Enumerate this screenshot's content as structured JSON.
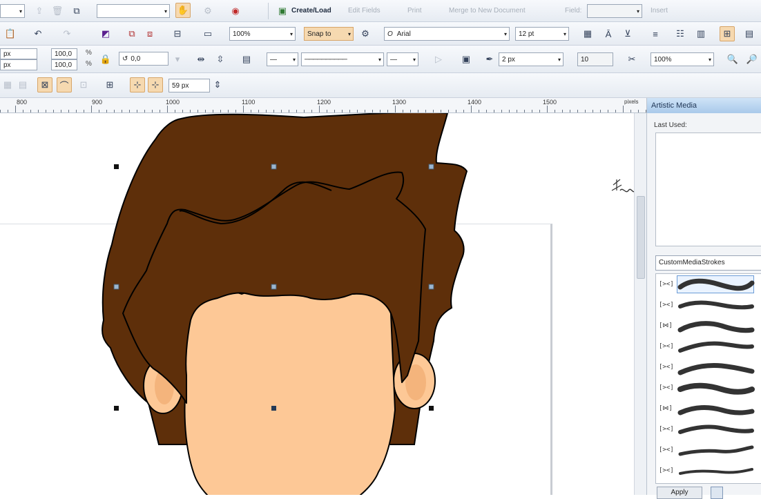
{
  "toolbar_standard": {
    "create_load": "Create/Load",
    "edit_fields": "Edit Fields",
    "print": "Print",
    "merge": "Merge to New Document",
    "field_label": "Field:",
    "insert": "Insert"
  },
  "toolbar_property": {
    "zoom": "100%",
    "snap_to": "Snap to",
    "font_name": "Arial",
    "font_size": "12 pt"
  },
  "toolbar_object": {
    "unit_x": "px",
    "unit_y": "px",
    "scale_x": "100,0",
    "scale_y": "100,0",
    "percent_x": "%",
    "percent_y": "%",
    "rotation": "0,0",
    "outline_width": "2 px",
    "miter": "10",
    "stretch": "100%"
  },
  "toolbar_artistic": {
    "width": "59 px"
  },
  "ruler": {
    "labels": [
      "800",
      "900",
      "1000",
      "1100",
      "1200",
      "1300",
      "1400",
      "1500"
    ],
    "unit": "pixels"
  },
  "docker": {
    "title": "Artistic Media",
    "last_used": "Last Used:",
    "brush_category": "CustomMediaStrokes",
    "stroke_icons": [
      "[><]",
      "[><]",
      "[⋈]",
      "[><]",
      "[><]",
      "[><]",
      "[⋈]",
      "[><]",
      "[><]",
      "[><]"
    ],
    "apply": "Apply"
  },
  "colors": {
    "hair": "#5e2f0a",
    "skin": "#fdc896",
    "ear_shadow": "#f4b47c",
    "outline": "#000000",
    "snap_highlight": "#f6d9b0",
    "docker_header": "#b9d4ef"
  }
}
